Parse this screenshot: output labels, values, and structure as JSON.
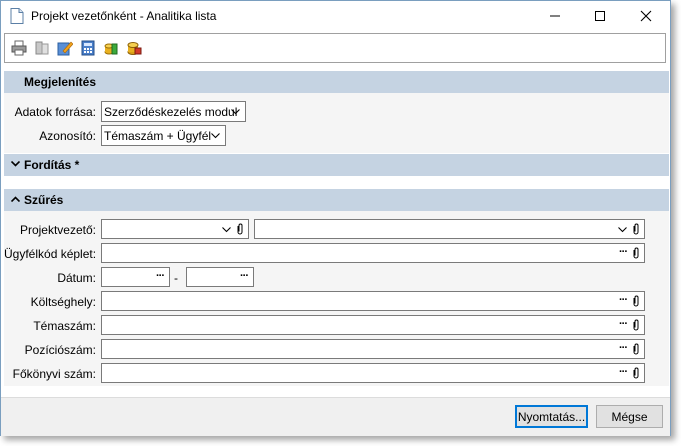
{
  "window": {
    "title": "Projekt vezetőnként - Analitika lista",
    "controls": [
      "minimize",
      "maximize",
      "close"
    ]
  },
  "toolbar": {
    "icons": [
      "printer-icon",
      "print-setup-icon",
      "edit-icon",
      "calculator-icon",
      "coins-icon",
      "export-icon"
    ]
  },
  "sections": {
    "megjelenites": {
      "title": "Megjelenítés",
      "adatok_forrasa_label": "Adatok forrása:",
      "adatok_forrasa_value": "Szerződéskezelés modul",
      "azonosito_label": "Azonosító:",
      "azonosito_value": "Témaszám + Ügyfél"
    },
    "forditas": {
      "title": "Fordítás *"
    },
    "szures": {
      "title": "Szűrés",
      "fields": {
        "projektvezeto": "Projektvezető:",
        "ugyfelkod": "Ügyfélkód képlet:",
        "datum": "Dátum:",
        "datum_separator": "-",
        "koltseghely": "Költséghely:",
        "temaszam": "Témaszám:",
        "poziciószam": "Pozíciószám:",
        "fokonyvi": "Főkönyvi szám:"
      }
    }
  },
  "buttons": {
    "print": "Nyomtatás...",
    "cancel": "Mégse"
  },
  "colors": {
    "section_header": "#c5d3e2",
    "panel": "#f5f5f5",
    "default_button_border": "#0078d7"
  }
}
